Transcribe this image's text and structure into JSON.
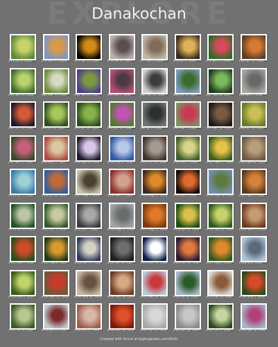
{
  "page": {
    "background_word": "EXPLORE",
    "title": "Danakochan",
    "footer": "Created with Scout at bighugelabs.com/flickr"
  },
  "colors": {
    "background": "#717171",
    "tile_border": "#ffffff",
    "title_text": "#f2f2f2",
    "caption_text": "#dcdcdc"
  },
  "photos": [
    {
      "caption": "#73 Oct 8, 2006",
      "colors": [
        "#5d8a3a",
        "#c8d46a"
      ]
    },
    {
      "caption": "#74 Dec 25, 2006",
      "colors": [
        "#7f95c2",
        "#d89a49"
      ]
    },
    {
      "caption": "#75 Apr 13, 2006",
      "colors": [
        "#050505",
        "#d48a18"
      ]
    },
    {
      "caption": "#76 Feb 17, 2007",
      "colors": [
        "#b7b0aa",
        "#5b4d52"
      ]
    },
    {
      "caption": "#77 Oct 5, 2006",
      "colors": [
        "#bfb7aa",
        "#806b57"
      ]
    },
    {
      "caption": "#78 Oct 2, 2006",
      "colors": [
        "#3a2b21",
        "#e0b35a"
      ]
    },
    {
      "caption": "#79 Jun 11, 2006",
      "colors": [
        "#2f6a2a",
        "#d64b5a"
      ]
    },
    {
      "caption": "#80 Apr 25, 2006",
      "colors": [
        "#5a3f27",
        "#d77a34"
      ]
    },
    {
      "caption": "#81 Mar 26, 2006",
      "colors": [
        "#3f6d2d",
        "#b9d26e"
      ]
    },
    {
      "caption": "#82 Mar 15, 2006",
      "colors": [
        "#6b8c3b",
        "#d7d9c3"
      ]
    },
    {
      "caption": "#83 Feb 14, 2007",
      "colors": [
        "#4f3d8f",
        "#7b9a3f"
      ]
    },
    {
      "caption": "#84 Nov 1, 2006",
      "colors": [
        "#b64d7a",
        "#4a3a3f"
      ]
    },
    {
      "caption": "#85 Oct 31, 2006",
      "colors": [
        "#cfd0cf",
        "#3d3b3b"
      ]
    },
    {
      "caption": "#86 Jan 11, 2007",
      "colors": [
        "#7a9ab8",
        "#3c6c2a"
      ]
    },
    {
      "caption": "#87 Feb 24, 2007",
      "colors": [
        "#1f3c1e",
        "#7aba5c"
      ]
    },
    {
      "caption": "#88 Nov 3, 2006",
      "colors": [
        "#a3a6a5",
        "#6b6863"
      ]
    },
    {
      "caption": "#89 Oct 16, 2006",
      "colors": [
        "#1b1a2a",
        "#d35b37"
      ]
    },
    {
      "caption": "#90 Jul 30, 2006",
      "colors": [
        "#2c4e1e",
        "#a8c65a"
      ]
    },
    {
      "caption": "#91 Jun 19, 2006",
      "colors": [
        "#2b4d1c",
        "#87b24a"
      ]
    },
    {
      "caption": "#92 Jun 11, 2006",
      "colors": [
        "#4f7a2c",
        "#c153b4"
      ]
    },
    {
      "caption": "#93 Jul 3, 2006",
      "colors": [
        "#6f7576",
        "#2e2f30"
      ]
    },
    {
      "caption": "#94 Mar 1, 2006",
      "colors": [
        "#7f8f63",
        "#c73a55"
      ]
    },
    {
      "caption": "#95 Dec 31, 2006",
      "colors": [
        "#1d1a18",
        "#7a5a40"
      ]
    },
    {
      "caption": "#96 Oct 24, 2006",
      "colors": [
        "#667a2a",
        "#c8c054"
      ]
    },
    {
      "caption": "#97 Mar 27, 2007",
      "colors": [
        "#3a4a2c",
        "#c6607a"
      ]
    },
    {
      "caption": "#98 Feb 27, 2007",
      "colors": [
        "#b14a44",
        "#dcc8a0"
      ]
    },
    {
      "caption": "#99 Sep 26, 2006",
      "colors": [
        "#1a1b28",
        "#d8c8e8"
      ]
    },
    {
      "caption": "#100 Feb 27, 2007",
      "colors": [
        "#3158a0",
        "#b8c9e8"
      ]
    },
    {
      "caption": "#101 Oct 16, 2006",
      "colors": [
        "#3f3530",
        "#a89a90"
      ]
    },
    {
      "caption": "#102 Oct 1, 2006",
      "colors": [
        "#405e2a",
        "#d8d48a"
      ]
    },
    {
      "caption": "#103 Sep 27, 2006",
      "colors": [
        "#3d5f19",
        "#e5c24a"
      ]
    },
    {
      "caption": "#104 Jun 22, 2006",
      "colors": [
        "#6b5a44",
        "#b79f7a"
      ]
    },
    {
      "caption": "#105 Oct 5, 2006",
      "colors": [
        "#3a7da8",
        "#9fd0d8"
      ]
    },
    {
      "caption": "#106 Jul 26, 2006",
      "colors": [
        "#2e5e9f",
        "#c06a3a"
      ]
    },
    {
      "caption": "#107 May 5, 2006",
      "colors": [
        "#c9c2a8",
        "#4b3f30"
      ]
    },
    {
      "caption": "#108 Nov 1, 2006",
      "colors": [
        "#8b2f2e",
        "#d4a28c"
      ]
    },
    {
      "caption": "#109 Aug 11, 2006",
      "colors": [
        "#3b2a1a",
        "#e18a2c"
      ]
    },
    {
      "caption": "#110 Jul 4, 2006",
      "colors": [
        "#0e0a0a",
        "#e06a30"
      ]
    },
    {
      "caption": "#111 May 18, 2006",
      "colors": [
        "#6f8fb0",
        "#5f7a3e"
      ]
    },
    {
      "caption": "#112 Nov 2, 2006",
      "colors": [
        "#5a3a1e",
        "#d6833a"
      ]
    },
    {
      "caption": "#113 Oct 23, 2006",
      "colors": [
        "#24502a",
        "#b9c6a4"
      ]
    },
    {
      "caption": "#114 Oct 1, 2006",
      "colors": [
        "#34582a",
        "#c7c9a0"
      ]
    },
    {
      "caption": "#115 Jul 7, 2006",
      "colors": [
        "#3a3a3a",
        "#a8a8a8"
      ]
    },
    {
      "caption": "#116 Aug 31, 2006",
      "colors": [
        "#a2a5a6",
        "#6a6c6d"
      ]
    },
    {
      "caption": "#117 Aug 15, 2006",
      "colors": [
        "#7a3a10",
        "#e07a2a"
      ]
    },
    {
      "caption": "#118 Jun 30, 2006",
      "colors": [
        "#1e4e14",
        "#d8c04a"
      ]
    },
    {
      "caption": "#119 Sep 24, 2006",
      "colors": [
        "#2a5a1e",
        "#c8d26a"
      ]
    },
    {
      "caption": "#120 Nov 25, 2006",
      "colors": [
        "#6a3a24",
        "#c89a72"
      ]
    },
    {
      "caption": "#121 Nov 1, 2006",
      "colors": [
        "#2a4e1c",
        "#d04a2a"
      ]
    },
    {
      "caption": "#122 Aug 8, 2006",
      "colors": [
        "#1f3a18",
        "#d89a30"
      ]
    },
    {
      "caption": "#123 Apr 25, 2006",
      "colors": [
        "#2f3a5a",
        "#d6d1c6"
      ]
    },
    {
      "caption": "#124 Jan 26, 2007",
      "colors": [
        "#1e1e1e",
        "#6f6f6f"
      ]
    },
    {
      "caption": "#125 Dec 31, 2006",
      "colors": [
        "#0f1f4a",
        "#ffffff"
      ]
    },
    {
      "caption": "#126 Oct 31, 2006",
      "colors": [
        "#2a1a30",
        "#e07a40"
      ]
    },
    {
      "caption": "#127 Aug 6, 2006",
      "colors": [
        "#2f5a1e",
        "#e08a2a"
      ]
    },
    {
      "caption": "#128 Jul 4, 2006",
      "colors": [
        "#b0c4d8",
        "#5a6a7a"
      ]
    },
    {
      "caption": "#129 Nov 6, 2006",
      "colors": [
        "#3a5a1e",
        "#c0d46a"
      ]
    },
    {
      "caption": "#130 Nov 26, 2006",
      "colors": [
        "#6a5a3a",
        "#c83a2a"
      ]
    },
    {
      "caption": "#131 Nov 18, 2006",
      "colors": [
        "#c4b8a0",
        "#6a5040"
      ]
    },
    {
      "caption": "#132 Mar 18, 2006",
      "colors": [
        "#6a3a2a",
        "#d8a880"
      ]
    },
    {
      "caption": "#133 Sep 19, 2006",
      "colors": [
        "#b8c8d8",
        "#c83a3a"
      ]
    },
    {
      "caption": "#134 Jul 30, 2006",
      "colors": [
        "#a8b8c8",
        "#2a5a2a"
      ]
    },
    {
      "caption": "#135 Jun 10, 2006",
      "colors": [
        "#dcd8d0",
        "#8a5a3a"
      ]
    },
    {
      "caption": "#136 May 2, 2006",
      "colors": [
        "#2a4a1a",
        "#d84a2a"
      ]
    },
    {
      "caption": "#137 Oct 8, 2006",
      "colors": [
        "#3a5a2a",
        "#b8c890"
      ]
    },
    {
      "caption": "#138 Jul 23, 2006",
      "colors": [
        "#c0c8cc",
        "#7a2a2a"
      ]
    },
    {
      "caption": "#139 Jul 12, 2006",
      "colors": [
        "#a05a4a",
        "#d8b8a8"
      ]
    },
    {
      "caption": "#140 Mar 18, 2006",
      "colors": [
        "#7a1a0a",
        "#e0502a"
      ]
    },
    {
      "caption": "#141 Apr 20, 2006",
      "colors": [
        "#a8a8a8",
        "#d8d8d8"
      ]
    },
    {
      "caption": "#142 Jan 28, 2006",
      "colors": [
        "#8a8a8a",
        "#c8c8c8"
      ]
    },
    {
      "caption": "#143 Oct 1, 2006",
      "colors": [
        "#2a4a1e",
        "#c8d4a0"
      ]
    },
    {
      "caption": "#144 Apr 28, 2006",
      "colors": [
        "#a0b8c8",
        "#b0407a"
      ]
    }
  ]
}
